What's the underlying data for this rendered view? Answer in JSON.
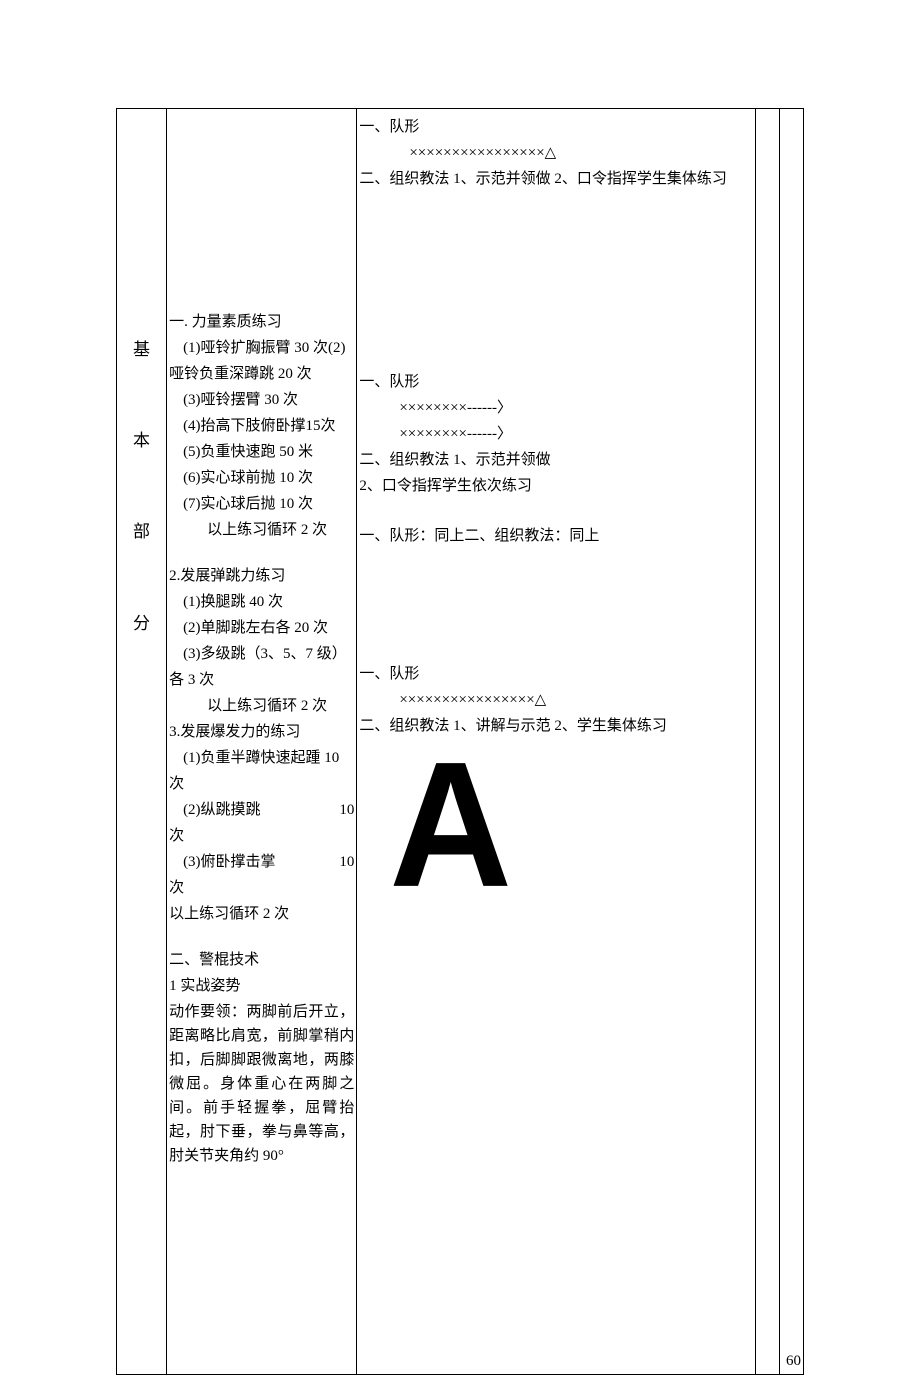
{
  "section": {
    "c1": "基",
    "c2": "本",
    "c3": "部",
    "c4": "分"
  },
  "content": {
    "h1": "一. 力量素质练习",
    "p1a": "(1)哑铃扩胸振臂 30 次(2)",
    "p1b": "哑铃负重深蹲跳 20 次",
    "p3": "(3)哑铃摆臂 30 次",
    "p4": "(4)抬高下肢俯卧撑15次",
    "p5": "(5)负重快速跑 50 米",
    "p6": "(6)实心球前抛 10 次",
    "p7": "(7)实心球后抛 10 次",
    "p8": "以上练习循环 2 次",
    "h2": "2.发展弹跳力练习",
    "p9": "(1)换腿跳 40 次",
    "p10": "(2)单脚跳左右各 20 次",
    "p11": "(3)多级跳（3、5、7 级）",
    "p11b": "各 3 次",
    "p12": "以上练习循环 2 次",
    "h3": "3.发展爆发力的练习",
    "p13": "(1)负重半蹲快速起踵 10",
    "p13b": "次",
    "p14a": "(2)纵跳摸跳",
    "p14b": "10",
    "p14c": "次",
    "p15a": "(3)俯卧撑击掌",
    "p15b": "10",
    "p15c": "次",
    "p16": "以上练习循环 2 次",
    "h4": "二、警棍技术",
    "h5": "1 实战姿势",
    "p17": "动作要领：两脚前后开立，距离略比肩宽，前脚掌稍内扣，后脚脚跟微离地，两膝微屈。身体重心在两脚之间。前手轻握拳，屈臂抬起，肘下垂，拳与鼻等高，肘关节夹角约 90°"
  },
  "method": {
    "b1_l1": "一、队形",
    "b1_l2": "××××××××××××××××△",
    "b1_l3": "二、组织教法 1、示范并领做 2、口令指挥学生集体练习",
    "b2_l1": "一、队形",
    "b2_l2": "××××××××------〉",
    "b2_l3": "××××××××------〉",
    "b2_l4": "二、组织教法 1、示范并领做",
    "b2_l5": "2、口令指挥学生依次练习",
    "b3_l1": "一、队形：同上二、组织教法：同上",
    "b4_l1": "一、队形",
    "b4_l2": "××××××××××××××××△",
    "b4_l3": "二、组织教法 1、讲解与示范 2、学生集体练习",
    "bigA": "A"
  },
  "footer": {
    "num": "60"
  }
}
